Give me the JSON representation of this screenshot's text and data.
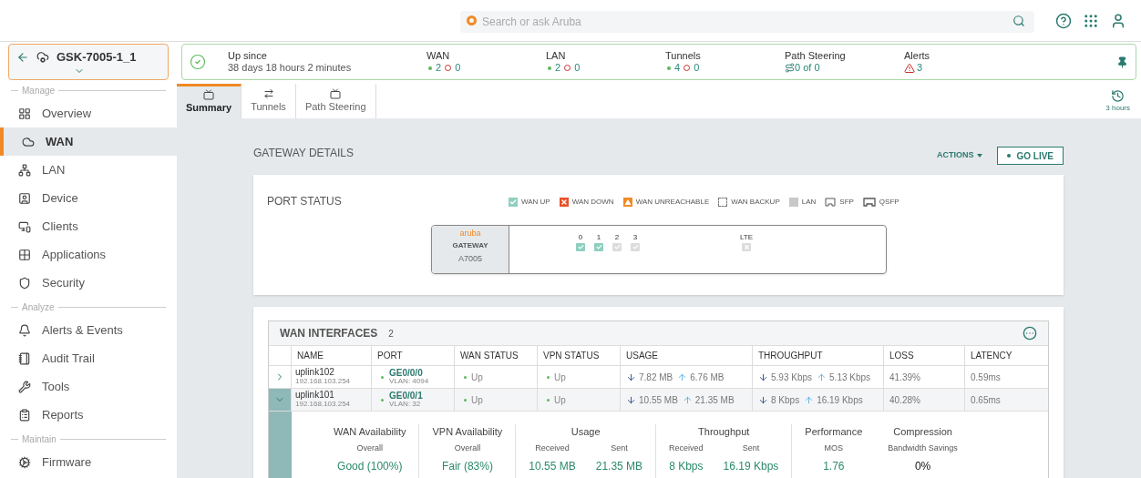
{
  "search": {
    "placeholder": "Search or ask Aruba"
  },
  "device": {
    "name": "GSK-7005-1_1"
  },
  "status": {
    "uptime_label": "Up since",
    "uptime_value": "38 days 18 hours 2 minutes",
    "metrics": [
      {
        "kind": "updown",
        "label": "WAN",
        "up": "2",
        "down": "0"
      },
      {
        "kind": "updown",
        "label": "LAN",
        "up": "2",
        "down": "0"
      },
      {
        "kind": "updown",
        "label": "Tunnels",
        "up": "4",
        "down": "0"
      },
      {
        "kind": "steering",
        "label": "Path Steering",
        "value": "0 of 0"
      },
      {
        "kind": "alert",
        "label": "Alerts",
        "value": "3"
      }
    ]
  },
  "sidebar": {
    "sections": [
      {
        "label": "Manage",
        "items": [
          {
            "label": "Overview",
            "selected": false
          },
          {
            "label": "WAN",
            "selected": true
          },
          {
            "label": "LAN",
            "selected": false
          },
          {
            "label": "Device",
            "selected": false
          },
          {
            "label": "Clients",
            "selected": false
          },
          {
            "label": "Applications",
            "selected": false
          },
          {
            "label": "Security",
            "selected": false
          }
        ]
      },
      {
        "label": "Analyze",
        "items": [
          {
            "label": "Alerts & Events",
            "selected": false
          },
          {
            "label": "Audit Trail",
            "selected": false
          },
          {
            "label": "Tools",
            "selected": false
          },
          {
            "label": "Reports",
            "selected": false
          }
        ]
      },
      {
        "label": "Maintain",
        "items": [
          {
            "label": "Firmware",
            "selected": false
          }
        ]
      }
    ]
  },
  "tabs": [
    {
      "label": "Summary",
      "selected": true
    },
    {
      "label": "Tunnels",
      "selected": false
    },
    {
      "label": "Path Steering",
      "selected": false
    }
  ],
  "time_range": "3 hours",
  "gateway_details": {
    "title": "GATEWAY DETAILS",
    "actions": "ACTIONS",
    "go_live": "GO LIVE"
  },
  "port_status": {
    "title": "PORT STATUS",
    "legend": [
      {
        "kind": "wan_up",
        "label": "WAN UP"
      },
      {
        "kind": "wan_down",
        "label": "WAN DOWN"
      },
      {
        "kind": "wan_unreachable",
        "label": "WAN UNREACHABLE"
      },
      {
        "kind": "wan_backup",
        "label": "WAN BACKUP"
      },
      {
        "kind": "lan",
        "label": "LAN"
      },
      {
        "kind": "sfp",
        "label": "SFP"
      },
      {
        "kind": "qsfp",
        "label": "QSFP"
      }
    ],
    "brand": "aruba",
    "model_type": "GATEWAY",
    "model": "A7005",
    "ports": [
      {
        "label": "0",
        "kind": "ethernet",
        "up": true
      },
      {
        "label": "1",
        "kind": "ethernet",
        "up": true
      },
      {
        "label": "2",
        "kind": "ethernet",
        "up": false
      },
      {
        "label": "3",
        "kind": "ethernet",
        "up": false
      }
    ],
    "lte": {
      "label": "LTE",
      "up": false
    }
  },
  "wan_interfaces": {
    "title": "WAN INTERFACES",
    "count": "2",
    "columns": [
      "NAME",
      "PORT",
      "WAN STATUS",
      "VPN STATUS",
      "USAGE",
      "THROUGHPUT",
      "LOSS",
      "LATENCY"
    ],
    "rows": [
      {
        "name": "uplink102",
        "ip": "192.168.103.254",
        "port": "GE0/0/0",
        "vlan": "VLAN: 4094",
        "wan_status": "Up",
        "vpn_status": "Up",
        "usage_down": "7.82 MB",
        "usage_up": "6.76 MB",
        "throughput_down": "5.93 Kbps",
        "throughput_up": "5.13 Kbps",
        "loss": "41.39%",
        "latency": "0.59ms",
        "expanded": false
      },
      {
        "name": "uplink101",
        "ip": "192.168.103.254",
        "port": "GE0/0/1",
        "vlan": "VLAN: 32",
        "wan_status": "Up",
        "vpn_status": "Up",
        "usage_down": "10.55 MB",
        "usage_up": "21.35 MB",
        "throughput_down": "8 Kbps",
        "throughput_up": "16.19 Kbps",
        "loss": "40.28%",
        "latency": "0.65ms",
        "expanded": true
      }
    ],
    "detail": [
      {
        "title": "WAN Availability",
        "items": [
          {
            "label": "Overall",
            "value": "Good (100%)",
            "highlight": true
          }
        ]
      },
      {
        "title": "VPN Availability",
        "items": [
          {
            "label": "Overall",
            "value": "Fair (83%)",
            "highlight": true
          }
        ]
      },
      {
        "title": "Usage",
        "items": [
          {
            "label": "Received",
            "value": "10.55 MB",
            "highlight": true
          },
          {
            "label": "Sent",
            "value": "21.35 MB",
            "highlight": true
          }
        ]
      },
      {
        "title": "Throughput",
        "items": [
          {
            "label": "Received",
            "value": "8 Kbps",
            "highlight": true
          },
          {
            "label": "Sent",
            "value": "16.19 Kbps",
            "highlight": true
          }
        ]
      },
      {
        "title": "Performance",
        "items": [
          {
            "label": "MOS",
            "value": "1.76",
            "highlight": true
          }
        ]
      },
      {
        "title": "Compression",
        "items": [
          {
            "label": "Bandwidth Savings",
            "value": "0%",
            "highlight": false
          }
        ]
      }
    ]
  }
}
